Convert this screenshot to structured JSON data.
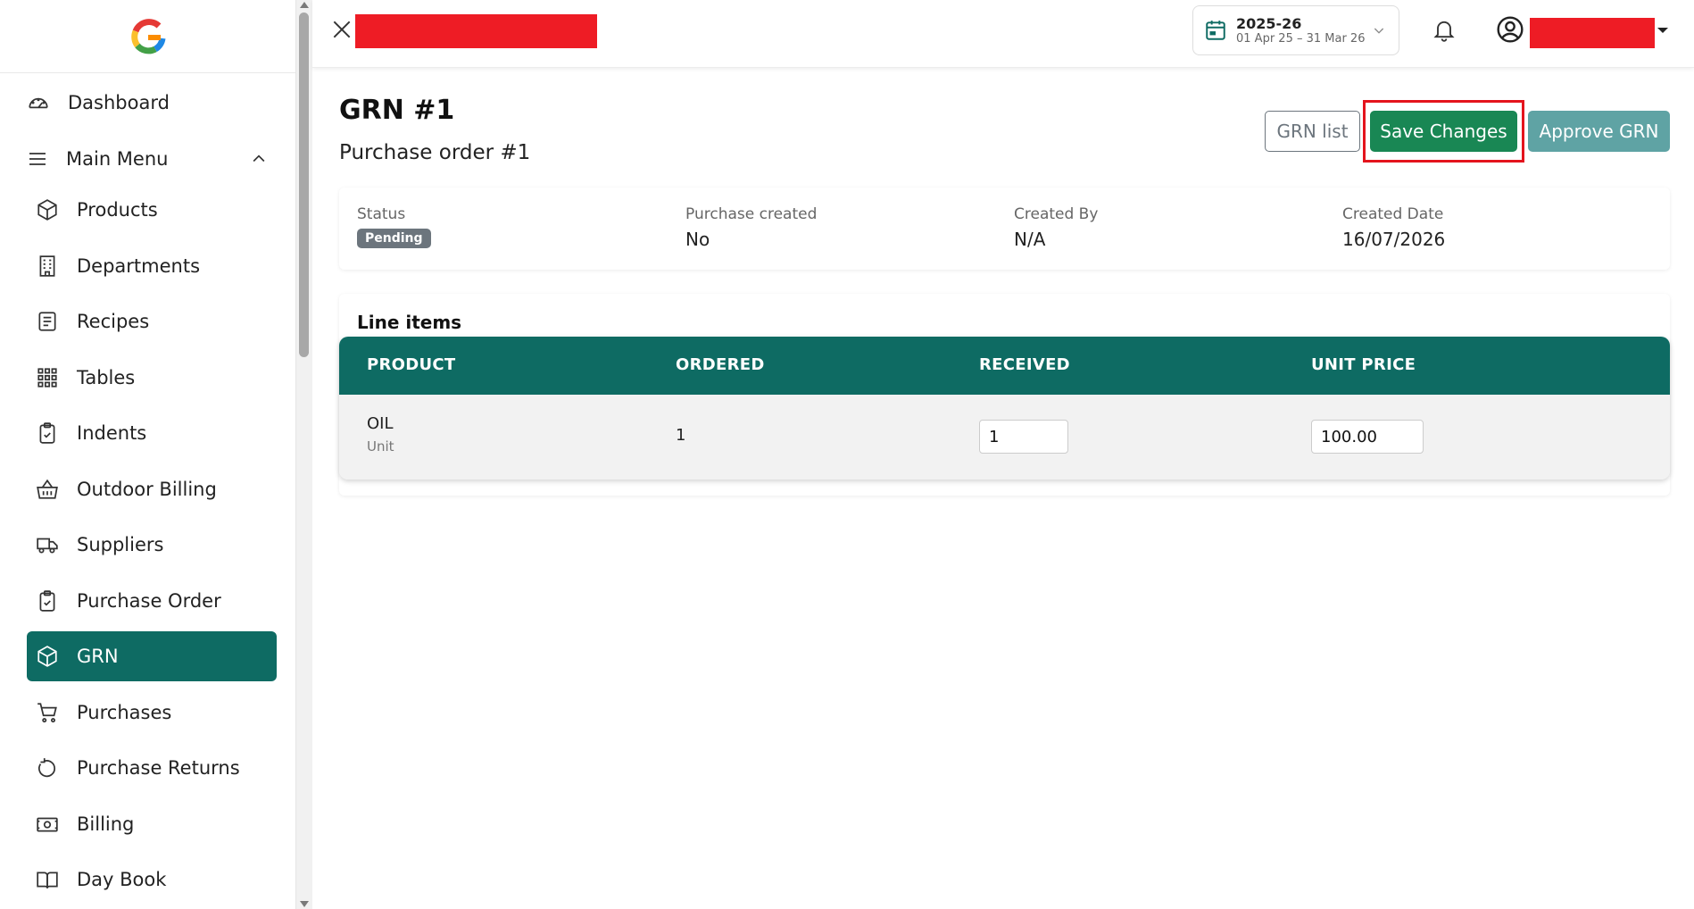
{
  "sidebar": {
    "dashboard": "Dashboard",
    "main_menu": "Main Menu",
    "items": [
      {
        "label": "Products",
        "icon": "box-icon"
      },
      {
        "label": "Departments",
        "icon": "building-icon"
      },
      {
        "label": "Recipes",
        "icon": "recipe-icon"
      },
      {
        "label": "Tables",
        "icon": "grid-icon"
      },
      {
        "label": "Indents",
        "icon": "clipboard-icon"
      },
      {
        "label": "Outdoor Billing",
        "icon": "basket-icon"
      },
      {
        "label": "Suppliers",
        "icon": "truck-icon"
      },
      {
        "label": "Purchase Order",
        "icon": "clipboard-check-icon"
      },
      {
        "label": "GRN",
        "icon": "box-icon",
        "active": true
      },
      {
        "label": "Purchases",
        "icon": "cart-icon"
      },
      {
        "label": "Purchase Returns",
        "icon": "rotate-icon"
      },
      {
        "label": "Billing",
        "icon": "cash-icon"
      },
      {
        "label": "Day Book",
        "icon": "book-icon"
      }
    ]
  },
  "topbar": {
    "fy_year": "2025-26",
    "fy_range": "01 Apr 25 – 31 Mar 26"
  },
  "page": {
    "title": "GRN #1",
    "subtitle": "Purchase order #1",
    "btn_grn_list": "GRN list",
    "btn_save": "Save Changes",
    "btn_approve": "Approve GRN"
  },
  "info": {
    "status_label": "Status",
    "status_value": "Pending",
    "purchase_created_label": "Purchase created",
    "purchase_created_value": "No",
    "created_by_label": "Created By",
    "created_by_value": "N/A",
    "created_date_label": "Created Date",
    "created_date_value": "16/07/2026"
  },
  "line_items": {
    "heading": "Line items",
    "columns": [
      "PRODUCT",
      "ORDERED",
      "RECEIVED",
      "UNIT PRICE"
    ],
    "rows": [
      {
        "product": "OIL",
        "unit": "Unit",
        "ordered": "1",
        "received": "1",
        "unit_price": "100.00"
      }
    ]
  },
  "colors": {
    "primary": "#0e6b63",
    "success": "#198754",
    "approve": "#5fa3a4",
    "highlight": "#e4141d",
    "redaction": "#ee1c25"
  }
}
